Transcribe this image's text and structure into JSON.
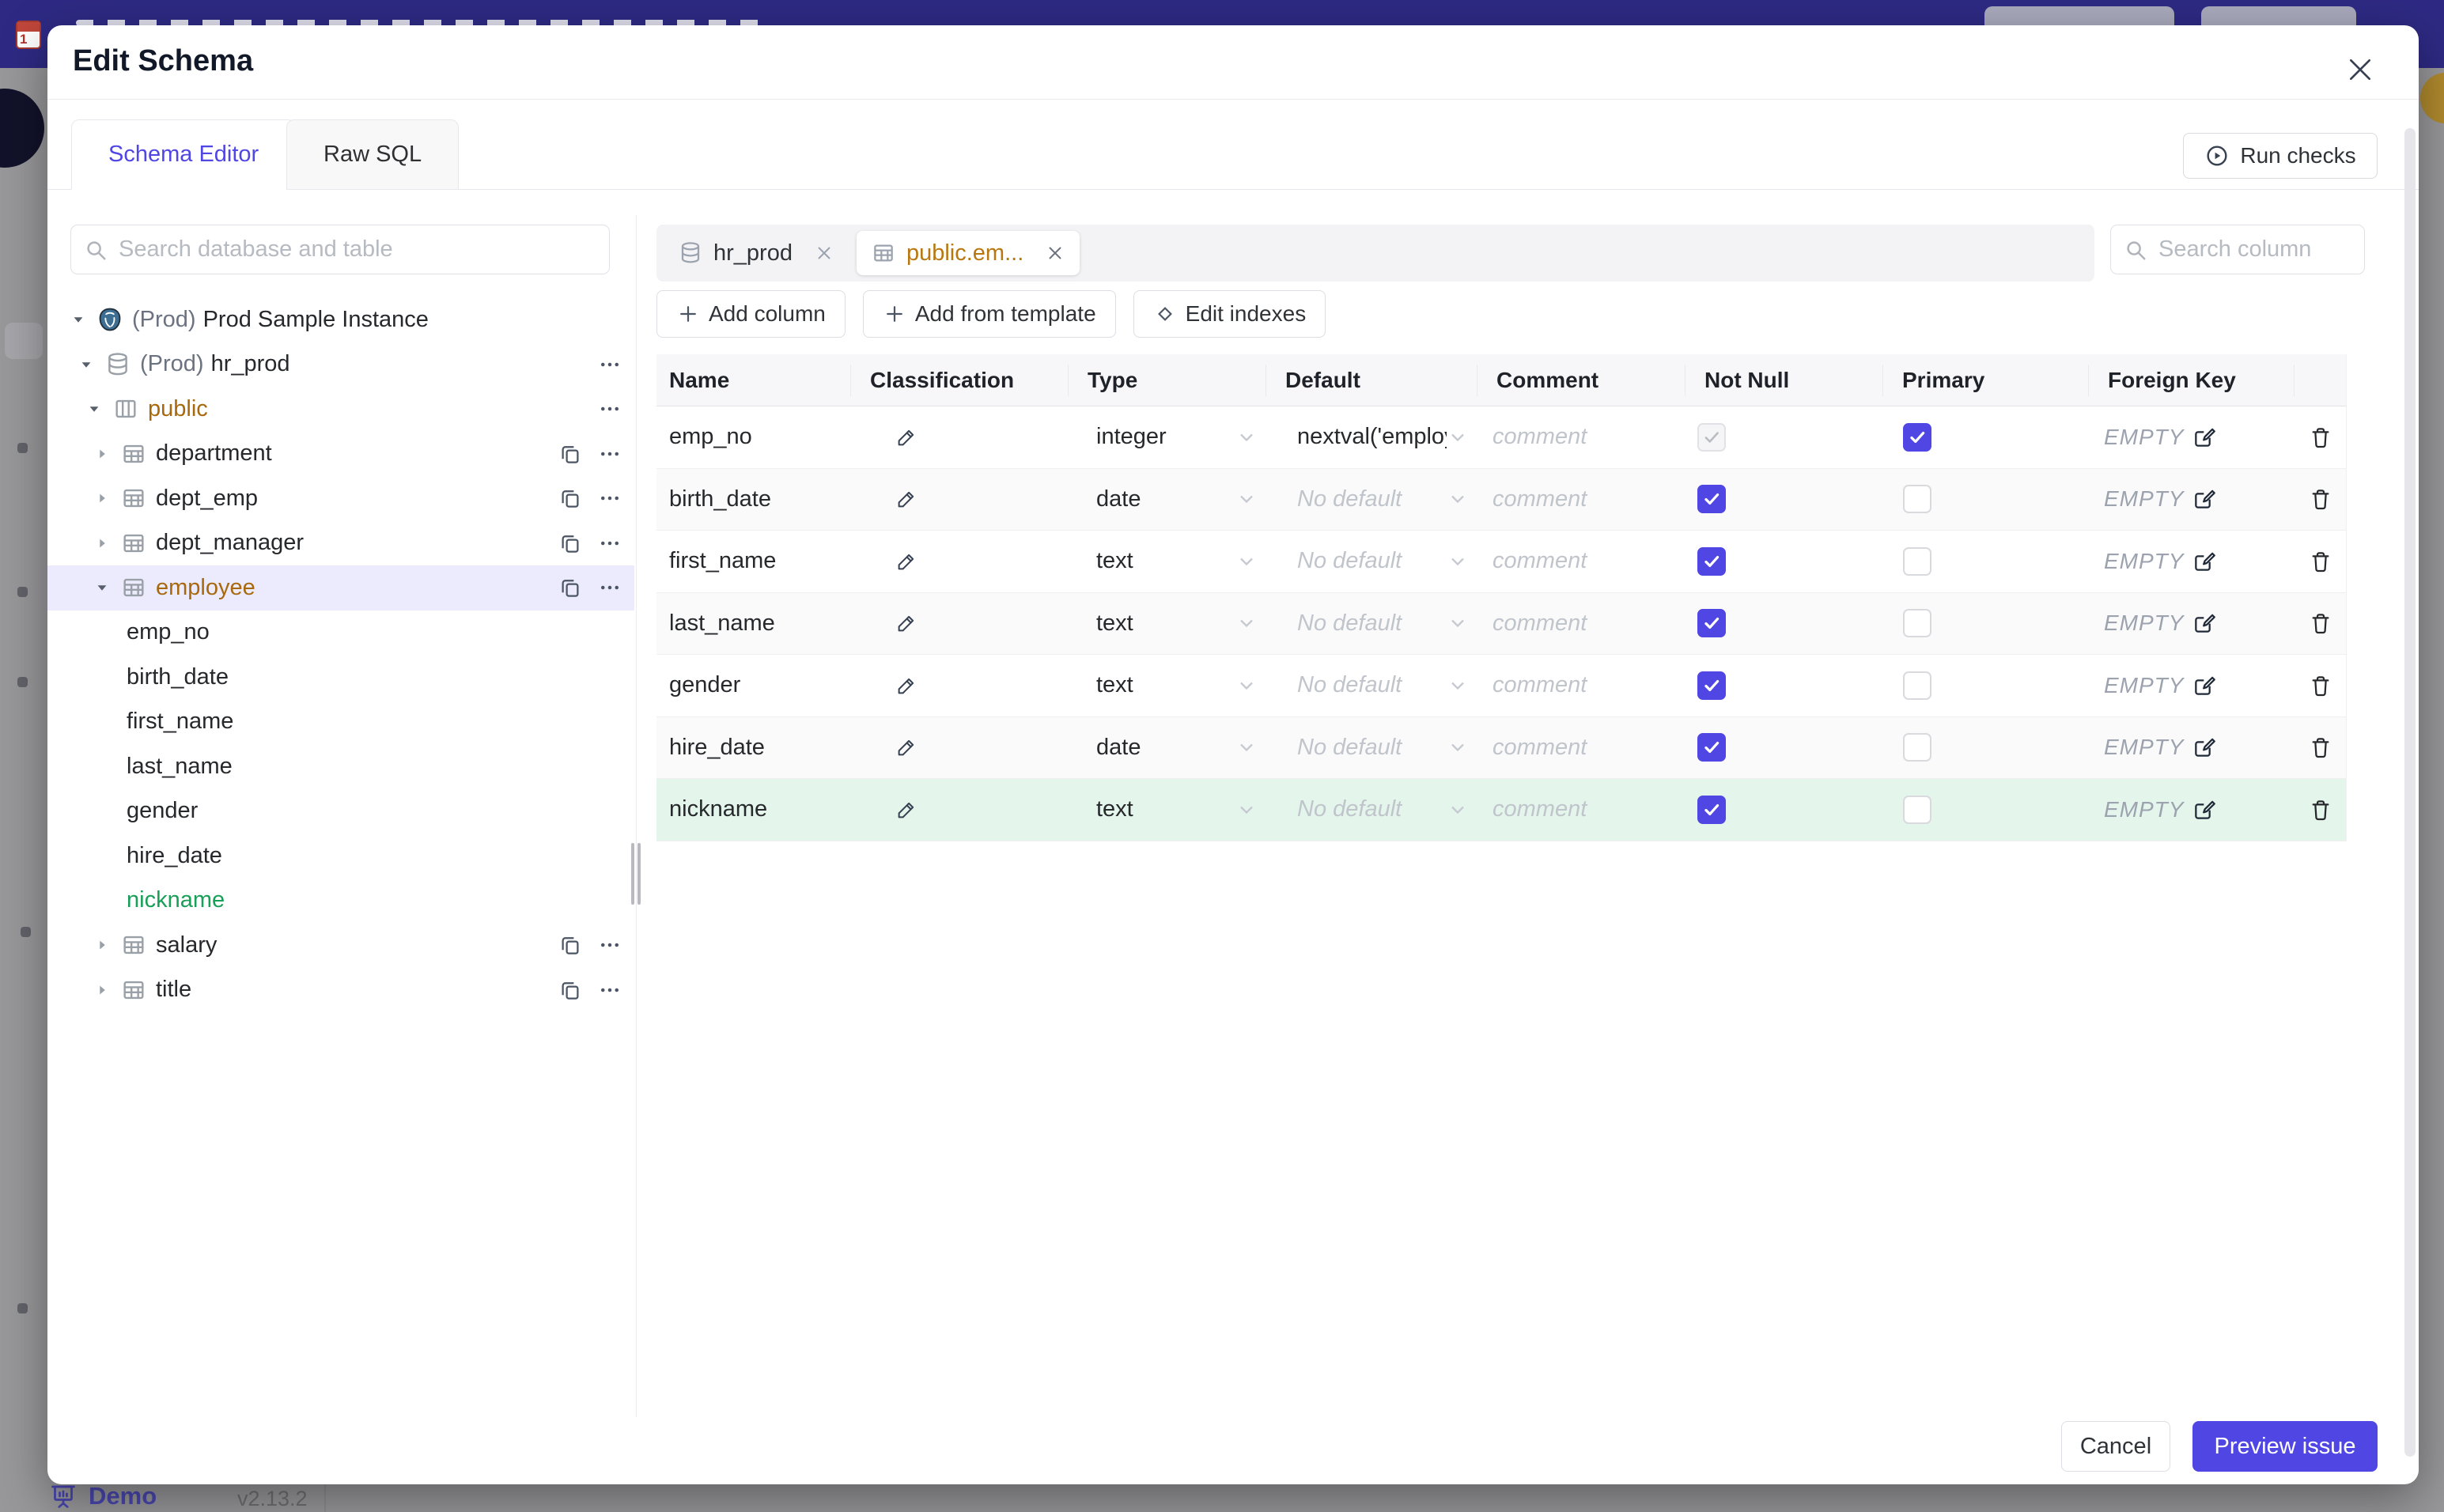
{
  "colors": {
    "accent": "#5046e4",
    "banner": "#2e2a84",
    "amber_changed": "#a8690e",
    "green_new": "#18a058",
    "selected_row_bg": "#ecebfd",
    "new_row_bg": "#e4f5ec"
  },
  "backdrop": {
    "demo_label": "Demo",
    "version": "v2.13.2"
  },
  "modal": {
    "title": "Edit Schema",
    "header_tabs": [
      {
        "label": "Schema Editor"
      },
      {
        "label": "Raw SQL"
      }
    ],
    "run_checks_label": "Run checks",
    "sidebar": {
      "search_placeholder": "Search database and table",
      "tree": [
        {
          "prefix": "(Prod)",
          "label": "Prod Sample Instance"
        },
        {
          "prefix": "(Prod)",
          "label": "hr_prod"
        },
        {
          "label": "public"
        },
        {
          "label": "department"
        },
        {
          "label": "dept_emp"
        },
        {
          "label": "dept_manager"
        },
        {
          "label": "employee"
        },
        {
          "label": "emp_no"
        },
        {
          "label": "birth_date"
        },
        {
          "label": "first_name"
        },
        {
          "label": "last_name"
        },
        {
          "label": "gender"
        },
        {
          "label": "hire_date"
        },
        {
          "label": "nickname"
        },
        {
          "label": "salary"
        },
        {
          "label": "title"
        }
      ]
    },
    "editor": {
      "tabs": [
        {
          "label": "hr_prod"
        },
        {
          "label": "public.em..."
        }
      ],
      "search_placeholder": "Search column",
      "toolbar": {
        "add_column": "Add column",
        "add_from_template": "Add from template",
        "edit_indexes": "Edit indexes"
      },
      "table": {
        "headers": [
          "Name",
          "Classification",
          "Type",
          "Default",
          "Comment",
          "Not Null",
          "Primary",
          "Foreign Key"
        ],
        "comment_placeholder": "comment",
        "fk_empty": "EMPTY",
        "rows": [
          {
            "name": "emp_no",
            "type": "integer",
            "default": "nextval('employ"
          },
          {
            "name": "birth_date",
            "type": "date",
            "default": "No default"
          },
          {
            "name": "first_name",
            "type": "text",
            "default": "No default"
          },
          {
            "name": "last_name",
            "type": "text",
            "default": "No default"
          },
          {
            "name": "gender",
            "type": "text",
            "default": "No default"
          },
          {
            "name": "hire_date",
            "type": "date",
            "default": "No default"
          },
          {
            "name": "nickname",
            "type": "text",
            "default": "No default"
          }
        ]
      }
    },
    "footer": {
      "cancel_label": "Cancel",
      "submit_label": "Preview issue"
    }
  }
}
